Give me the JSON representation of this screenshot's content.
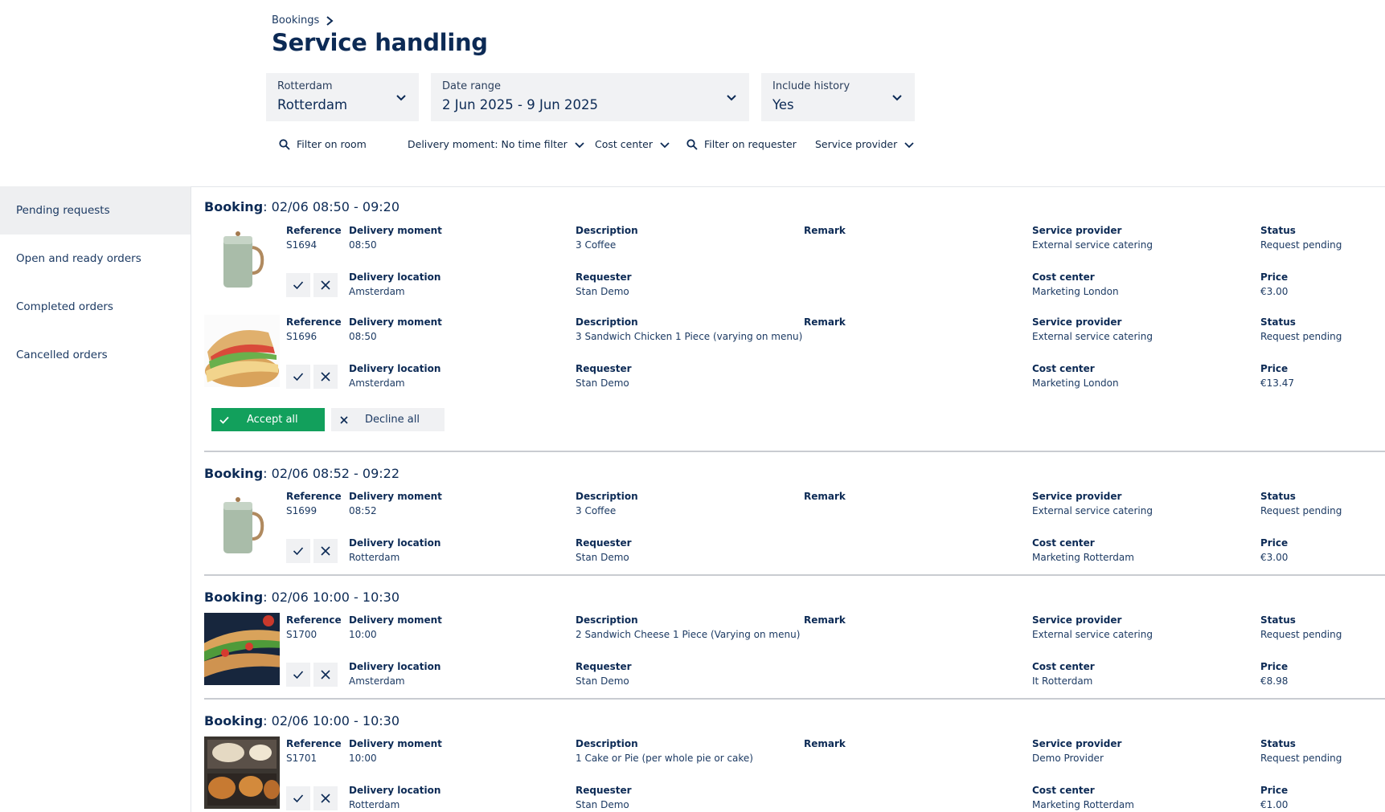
{
  "breadcrumb": {
    "label": "Bookings"
  },
  "page_title": "Service handling",
  "selects": {
    "building": {
      "label": "Rotterdam",
      "value": "Rotterdam"
    },
    "date_range": {
      "label": "Date range",
      "value": "2 Jun 2025 - 9 Jun 2025"
    },
    "history": {
      "label": "Include history",
      "value": "Yes"
    }
  },
  "filters": {
    "room": "Filter on room",
    "delivery_moment": "Delivery moment: No time filter",
    "cost_center": "Cost center",
    "requester": "Filter on requester",
    "service_provider": "Service provider"
  },
  "sidebar": {
    "items": [
      {
        "label": "Pending requests"
      },
      {
        "label": "Open and ready orders"
      },
      {
        "label": "Completed orders"
      },
      {
        "label": "Cancelled orders"
      }
    ]
  },
  "field_labels": {
    "reference": "Reference",
    "delivery_moment": "Delivery moment",
    "description": "Description",
    "remark": "Remark",
    "service_provider": "Service provider",
    "status": "Status",
    "delivery_location": "Delivery location",
    "requester": "Requester",
    "cost_center": "Cost center",
    "price": "Price"
  },
  "booking_prefix": "Booking",
  "bulk": {
    "accept_all": "Accept all",
    "decline_all": "Decline all"
  },
  "bookings": [
    {
      "time": ": 02/06 08:50 - 09:20",
      "orders": [
        {
          "image": "coffee-pot",
          "reference": "S1694",
          "delivery_moment": "08:50",
          "description": "3 Coffee",
          "service_provider": "External service catering",
          "status": "Request pending",
          "delivery_location": "Amsterdam",
          "requester": "Stan Demo",
          "cost_center": "Marketing London",
          "price": "€3.00"
        },
        {
          "image": "sandwich",
          "reference": "S1696",
          "delivery_moment": "08:50",
          "description": "3 Sandwich Chicken 1 Piece (varying on menu)",
          "service_provider": "External service catering",
          "status": "Request pending",
          "delivery_location": "Amsterdam",
          "requester": "Stan Demo",
          "cost_center": "Marketing London",
          "price": "€13.47"
        }
      ]
    },
    {
      "time": ": 02/06 08:52 - 09:22",
      "orders": [
        {
          "image": "coffee-pot",
          "reference": "S1699",
          "delivery_moment": "08:52",
          "description": "3 Coffee",
          "service_provider": "External service catering",
          "status": "Request pending",
          "delivery_location": "Rotterdam",
          "requester": "Stan Demo",
          "cost_center": "Marketing Rotterdam",
          "price": "€3.00"
        }
      ]
    },
    {
      "time": ": 02/06 10:00 - 10:30",
      "orders": [
        {
          "image": "baguette",
          "reference": "S1700",
          "delivery_moment": "10:00",
          "description": "2 Sandwich Cheese 1 Piece (Varying on menu)",
          "service_provider": "External service catering",
          "status": "Request pending",
          "delivery_location": "Amsterdam",
          "requester": "Stan Demo",
          "cost_center": "It Rotterdam",
          "price": "€8.98"
        }
      ]
    },
    {
      "time": ": 02/06 10:00 - 10:30",
      "orders": [
        {
          "image": "pies",
          "reference": "S1701",
          "delivery_moment": "10:00",
          "description": "1 Cake or Pie (per whole pie or cake)",
          "service_provider": "Demo Provider",
          "status": "Request pending",
          "delivery_location": "Rotterdam",
          "requester": "Stan Demo",
          "cost_center": "Marketing Rotterdam",
          "price": "€1.00"
        }
      ]
    }
  ]
}
